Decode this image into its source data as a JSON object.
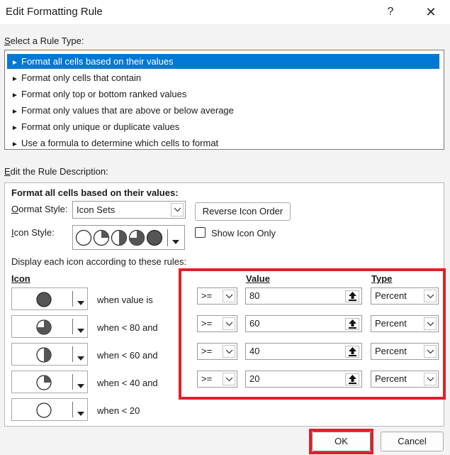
{
  "window": {
    "title": "Edit Formatting Rule",
    "help_glyph": "?",
    "close_glyph": "✕"
  },
  "rule_type": {
    "label": "Select a Rule Type:",
    "items": [
      "Format all cells based on their values",
      "Format only cells that contain",
      "Format only top or bottom ranked values",
      "Format only values that are above or below average",
      "Format only unique or duplicate values",
      "Use a formula to determine which cells to format"
    ],
    "selected_index": 0,
    "bullet": "►"
  },
  "description": {
    "label": "Edit the Rule Description:",
    "heading": "Format all cells based on their values:",
    "format_style_label": "Format Style:",
    "format_style_value": "Icon Sets",
    "reverse_button": "Reverse Icon Order",
    "icon_style_label": "Icon Style:",
    "icon_style_value": "Harvey balls (5)",
    "show_icon_only": "Show Icon Only",
    "show_icon_only_checked": false,
    "display_rules_label": "Display each icon according to these rules:",
    "col_icon": "Icon",
    "col_value": "Value",
    "col_type": "Type",
    "rules": [
      {
        "icon": "harvey-full-icon",
        "condition": "when value is",
        "operator": ">=",
        "value": "80",
        "type": "Percent"
      },
      {
        "icon": "harvey-three-quarter-icon",
        "condition": "when < 80 and",
        "operator": ">=",
        "value": "60",
        "type": "Percent"
      },
      {
        "icon": "harvey-half-icon",
        "condition": "when < 60 and",
        "operator": ">=",
        "value": "40",
        "type": "Percent"
      },
      {
        "icon": "harvey-quarter-icon",
        "condition": "when < 40 and",
        "operator": ">=",
        "value": "20",
        "type": "Percent"
      },
      {
        "icon": "harvey-empty-icon",
        "condition": "when < 20"
      }
    ]
  },
  "footer": {
    "ok": "OK",
    "cancel": "Cancel"
  },
  "colors": {
    "selection": "#0078d4",
    "highlight": "#e0202a",
    "background": "#f3f3f3"
  }
}
